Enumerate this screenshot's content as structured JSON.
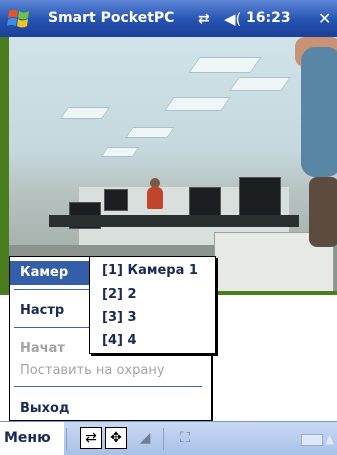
{
  "titlebar": {
    "app_name": "Smart PocketPC",
    "time": "16:23",
    "close_label": "✕",
    "connectivity_icon": "sync-arrows-icon",
    "volume_icon": "speaker-icon"
  },
  "context_menu": {
    "items": [
      {
        "label": "Камер",
        "state": "selected"
      },
      {
        "label": "Настр",
        "state": "normal"
      },
      {
        "label": "Начат",
        "state": "disabled"
      },
      {
        "label": "Поставить на охрану",
        "state": "disabled"
      },
      {
        "label": "Выход",
        "state": "normal"
      }
    ]
  },
  "submenu": {
    "items": [
      {
        "label": "[1] Камера 1"
      },
      {
        "label": "[2] 2"
      },
      {
        "label": "[3] 3"
      },
      {
        "label": "[4] 4"
      }
    ]
  },
  "toolbar": {
    "menu_label": "Меню",
    "tools": [
      {
        "icon": "swap-arrows-icon",
        "glyph": "⇄"
      },
      {
        "icon": "zoom-fit-icon",
        "glyph": "✥"
      },
      {
        "icon": "triangle-icon",
        "glyph": "◢"
      },
      {
        "icon": "fullscreen-icon",
        "glyph": "⛶"
      }
    ],
    "keyboard_icon": "keyboard-icon"
  },
  "colors": {
    "titlebar": "#2452b0",
    "selection": "#355ea8",
    "menu_text": "#1a2a55",
    "disabled_text": "#a4a4a4"
  }
}
